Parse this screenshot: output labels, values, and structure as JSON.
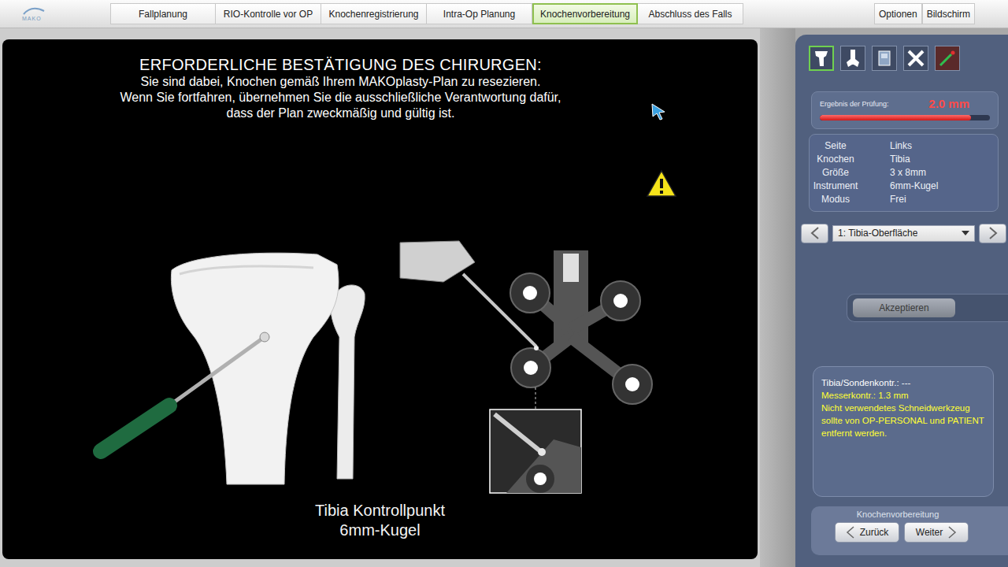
{
  "logo": "MAKO",
  "tabs": [
    {
      "label": "Fallplanung",
      "selected": false
    },
    {
      "label": "RIO-Kontrolle vor OP",
      "selected": false
    },
    {
      "label": "Knochenregistrierung",
      "selected": false
    },
    {
      "label": "Intra-Op Planung",
      "selected": false
    },
    {
      "label": "Knochenvorbereitung",
      "selected": true
    },
    {
      "label": "Abschluss des Falls",
      "selected": false
    }
  ],
  "menu": [
    "Optionen",
    "Bildschirm"
  ],
  "confirmation": {
    "title": "ERFORDERLICHE BESTÄTIGUNG DES CHIRURGEN:",
    "lines": [
      "Sie sind dabei, Knochen gemäß Ihrem MAKOplasty-Plan zu resezieren.",
      "Wenn Sie fortfahren, übernehmen Sie die ausschließliche Verantwortung dafür,",
      "dass der Plan zweckmäßig und gültig ist."
    ]
  },
  "figure": {
    "caption": [
      "Tibia Kontrollpunkt",
      "6mm-Kugel"
    ]
  },
  "toolbar": [
    {
      "selected": true
    },
    {
      "selected": false
    },
    {
      "selected": false
    },
    {
      "selected": false
    },
    {
      "selected": false
    }
  ],
  "check": {
    "label": "Ergebnis der Prüfung:",
    "value": "2.0 mm",
    "level": 0.89
  },
  "info": [
    {
      "key": "Seite",
      "value": "Links"
    },
    {
      "key": "Knochen",
      "value": "Tibia"
    },
    {
      "key": "Größe",
      "value": "3 x 8mm"
    },
    {
      "key": "Instrument",
      "value": "6mm-Kugel"
    },
    {
      "key": "Modus",
      "value": "Frei"
    }
  ],
  "step": {
    "value": "1: Tibia-Oberfläche"
  },
  "accept": {
    "label": "Akzeptieren",
    "disabled": true
  },
  "messages": [
    {
      "text": "Tibia/Sondenkontr.: ---",
      "color": "#ffffff"
    },
    {
      "text": "Messerkontr.: 1.3 mm",
      "color": "#ffff33"
    },
    {
      "text": "Nicht verwendetes Schneidwerkzeug sollte von OP-PERSONAL und PATIENT entfernt werden.",
      "color": "#ffff33"
    }
  ],
  "footer": {
    "title": "Knochenvorbereitung",
    "buttons": [
      "Zurück",
      "Weiter"
    ]
  }
}
